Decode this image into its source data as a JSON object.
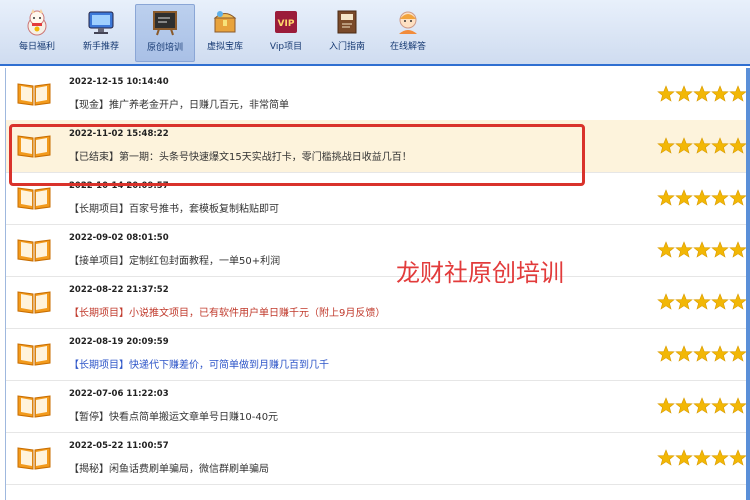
{
  "toolbar": {
    "items": [
      {
        "label": "每日福利",
        "icon": "lucky-cat-icon",
        "active": false
      },
      {
        "label": "新手推荐",
        "icon": "monitor-icon",
        "active": false
      },
      {
        "label": "原创培训",
        "icon": "chalkboard-icon",
        "active": true
      },
      {
        "label": "虚拟宝库",
        "icon": "treasure-box-icon",
        "active": false
      },
      {
        "label": "Vip项目",
        "icon": "vip-badge-icon",
        "active": false
      },
      {
        "label": "入门指南",
        "icon": "guide-book-icon",
        "active": false
      },
      {
        "label": "在线解答",
        "icon": "support-avatar-icon",
        "active": false
      }
    ]
  },
  "list": {
    "rows": [
      {
        "date": "2022-12-15 10:14:40",
        "text": "【现金】推广养老金开户，日赚几百元，非常简单",
        "color": "#333333",
        "stars": 5,
        "highlighted": false
      },
      {
        "date": "2022-11-02 15:48:22",
        "text": "【已结束】第一期：头条号快速爆文15天实战打卡，零门槛挑战日收益几百！",
        "color": "#333333",
        "stars": 5,
        "highlighted": true
      },
      {
        "date": "2022-10-14 20:09:57",
        "text": "【长期项目】百家号推书，套模板复制粘贴即可",
        "color": "#333333",
        "stars": 5,
        "highlighted": false
      },
      {
        "date": "2022-09-02 08:01:50",
        "text": "【接单项目】定制红包封面教程，一单50+利润",
        "color": "#333333",
        "stars": 5,
        "highlighted": false
      },
      {
        "date": "2022-08-22 21:37:52",
        "text": "【长期项目】小说推文项目，已有软件用户单日赚千元（附上9月反馈）",
        "color": "#c0392b",
        "stars": 5,
        "highlighted": false
      },
      {
        "date": "2022-08-19 20:09:59",
        "text": "【长期项目】快递代下赚差价，可简单做到月赚几百到几千",
        "color": "#2d55c8",
        "stars": 5,
        "highlighted": false
      },
      {
        "date": "2022-07-06 11:22:03",
        "text": "【暂停】快看点简单搬运文章单号日赚10-40元",
        "color": "#333333",
        "stars": 5,
        "highlighted": false
      },
      {
        "date": "2022-05-22 11:00:57",
        "text": "【揭秘】闲鱼话费刷单骗局，微信群刷单骗局",
        "color": "#333333",
        "stars": 5,
        "highlighted": false
      }
    ]
  },
  "overlay_text": "龙财社原创培训",
  "colors": {
    "accent": "#2f6fd1",
    "star": "#f2b705",
    "highlight_border": "#d9322b",
    "highlight_bg": "#fdf3dc"
  }
}
